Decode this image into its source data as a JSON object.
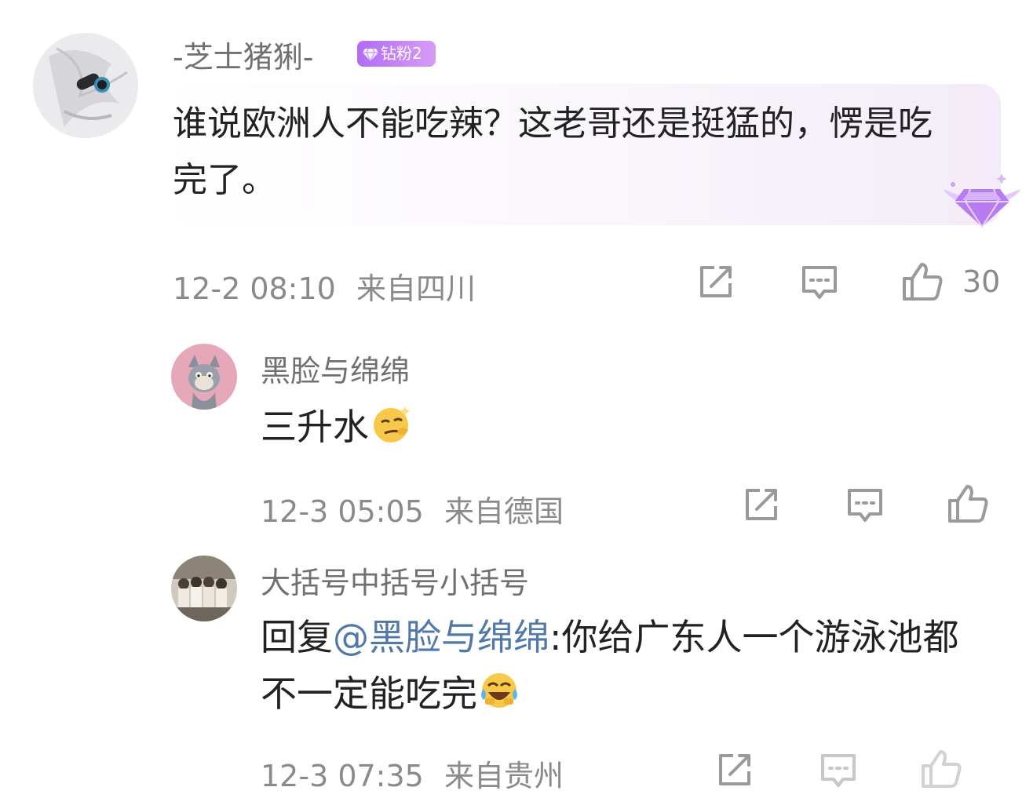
{
  "comment": {
    "author": "-芝士猪猁-",
    "badge_label": "钻粉2",
    "text": "谁说欧洲人不能吃辣？这老哥还是挺猛的，愣是吃完了。",
    "time": "12-2 08:10",
    "location": "来自四川",
    "like_count": "30"
  },
  "replies": [
    {
      "author": "黑脸与绵绵",
      "text": "三升水",
      "emoji": "smirk-emoji",
      "time": "12-3 05:05",
      "location": "来自德国"
    },
    {
      "author": "大括号中括号小括号",
      "reply_prefix": "回复",
      "mention": "@黑脸与绵绵",
      "text": ":你给广东人一个游泳池都不一定能吃完",
      "emoji": "laugh-cry-emoji",
      "time": "12-3 07:35",
      "location": "来自贵州"
    }
  ],
  "icons": {
    "share": "share-icon",
    "comment": "comment-icon",
    "like": "thumbs-up-icon"
  },
  "colors": {
    "badge": "#b06cf3",
    "mention": "#5078a8",
    "meta_text": "#8a8a8a"
  }
}
